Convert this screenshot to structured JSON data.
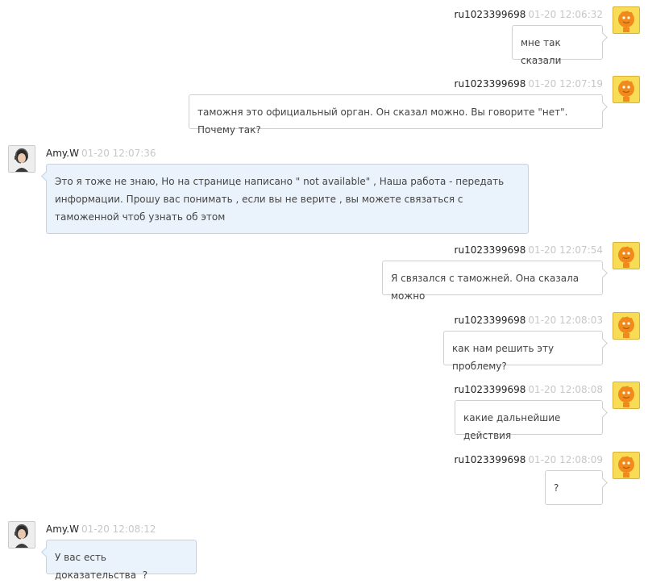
{
  "messages": [
    {
      "sender": "ru1023399698",
      "time": "01-20 12:06:32",
      "text": "мне так сказали",
      "avatar_icon": "orange-character-avatar-icon"
    },
    {
      "sender": "ru1023399698",
      "time": "01-20 12:07:19",
      "text": "таможня это официальный орган. Он сказал можно. Вы говорите \"нет\". Почему так?",
      "avatar_icon": "orange-character-avatar-icon"
    },
    {
      "sender": "Amy.W",
      "time": "01-20 12:07:36",
      "text": "Это я тоже не знаю, Но на странице написано \" not available\" , Наша работа - передать информации. Прошу вас понимать , если вы не верите , вы можете связаться с таможенной чтоб узнать об этом",
      "avatar_icon": "agent-headset-avatar-icon"
    },
    {
      "sender": "ru1023399698",
      "time": "01-20 12:07:54",
      "text": "Я связался с таможней. Она сказала можно",
      "avatar_icon": "orange-character-avatar-icon"
    },
    {
      "sender": "ru1023399698",
      "time": "01-20 12:08:03",
      "text": "как нам решить эту проблему?",
      "avatar_icon": "orange-character-avatar-icon"
    },
    {
      "sender": "ru1023399698",
      "time": "01-20 12:08:08",
      "text": "какие дальнейшие действия",
      "avatar_icon": "orange-character-avatar-icon"
    },
    {
      "sender": "ru1023399698",
      "time": "01-20 12:08:09",
      "text": "?",
      "avatar_icon": "orange-character-avatar-icon"
    },
    {
      "sender": "Amy.W",
      "time": "01-20 12:08:12",
      "text": "У вас есть доказательства  ?",
      "avatar_icon": "agent-headset-avatar-icon"
    }
  ],
  "colors": {
    "outgoing_bubble_bg": "#ffffff",
    "outgoing_bubble_border": "#cfcfcf",
    "incoming_bubble_bg": "#eaf3fc",
    "incoming_bubble_border": "#b9d5f0",
    "timestamp": "#c7c7c7"
  }
}
